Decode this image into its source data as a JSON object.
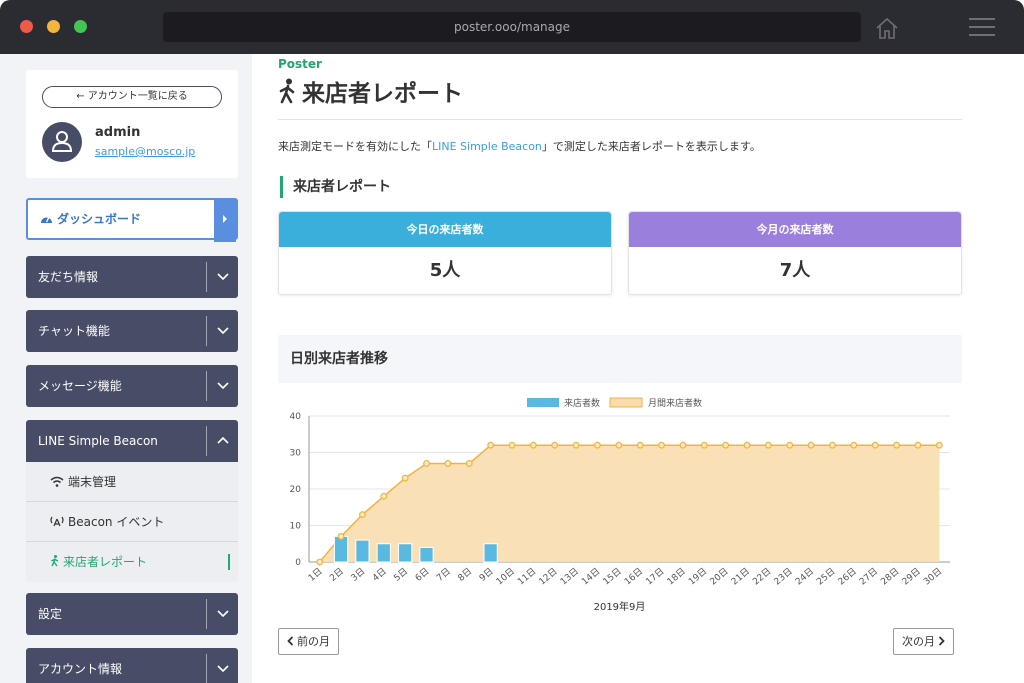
{
  "browser": {
    "url": "poster.ooo/manage"
  },
  "sidebar": {
    "back_label": "← アカウント一覧に戻る",
    "user": {
      "name": "admin",
      "email": "sample@mosco.jp"
    },
    "items": [
      {
        "label": "ダッシュボード",
        "icon": "dashboard-icon"
      },
      {
        "label": "友だち情報"
      },
      {
        "label": "チャット機能"
      },
      {
        "label": "メッセージ機能"
      },
      {
        "label": "LINE Simple Beacon"
      },
      {
        "label": "設定"
      },
      {
        "label": "アカウント情報"
      }
    ],
    "beacon_sub": [
      {
        "label": "端末管理",
        "icon": "wifi-icon"
      },
      {
        "label": "Beacon イベント",
        "icon": "beacon-icon"
      },
      {
        "label": "来店者レポート",
        "icon": "walk-icon"
      }
    ]
  },
  "main": {
    "brand": "Poster",
    "title": "来店者レポート",
    "description_pre": "来店測定モードを有効にした「",
    "description_link": "LINE Simple Beacon",
    "description_post": "」で測定した来店者レポートを表示します。",
    "section_title": "来店者レポート",
    "today": {
      "label": "今日の来店者数",
      "value": "5人",
      "color": "#3aafdc"
    },
    "month": {
      "label": "今月の来店者数",
      "value": "7人",
      "color": "#9a7fdc"
    },
    "chart_title": "日別来店者推移",
    "prev_label": "前の月",
    "next_label": "次の月"
  },
  "chart_data": {
    "type": "bar",
    "categories": [
      "1日",
      "2日",
      "3日",
      "4日",
      "5日",
      "6日",
      "7日",
      "8日",
      "9日",
      "10日",
      "11日",
      "12日",
      "13日",
      "14日",
      "15日",
      "16日",
      "17日",
      "18日",
      "19日",
      "20日",
      "21日",
      "22日",
      "23日",
      "24日",
      "25日",
      "26日",
      "27日",
      "28日",
      "29日",
      "30日"
    ],
    "series": [
      {
        "name": "来店者数",
        "type": "bar",
        "color": "#5ab9e0",
        "values": [
          0,
          7,
          6,
          5,
          5,
          4,
          0,
          0,
          5,
          0,
          0,
          0,
          0,
          0,
          0,
          0,
          0,
          0,
          0,
          0,
          0,
          0,
          0,
          0,
          0,
          0,
          0,
          0,
          0,
          0
        ]
      },
      {
        "name": "月間来店者数",
        "type": "area",
        "color": "#f2b33d",
        "values": [
          0,
          7,
          13,
          18,
          23,
          27,
          27,
          27,
          32,
          32,
          32,
          32,
          32,
          32,
          32,
          32,
          32,
          32,
          32,
          32,
          32,
          32,
          32,
          32,
          32,
          32,
          32,
          32,
          32,
          32
        ]
      }
    ],
    "xlabel": "2019年9月",
    "ylim": [
      0,
      40
    ],
    "yticks": [
      0,
      10,
      20,
      30,
      40
    ],
    "legend": "top"
  }
}
